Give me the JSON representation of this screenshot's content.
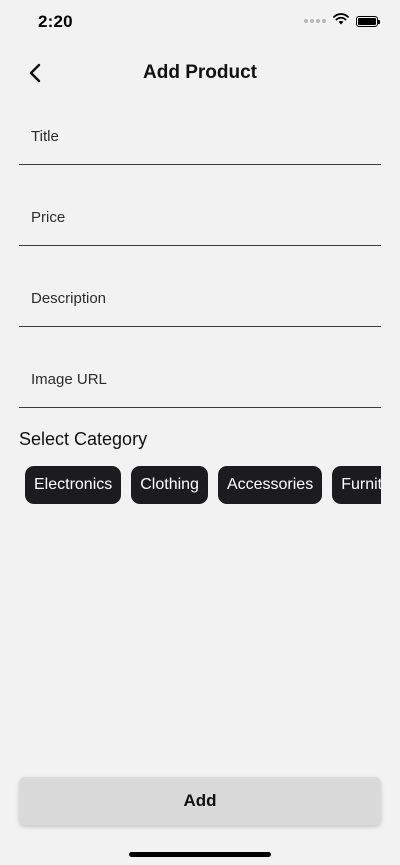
{
  "status_bar": {
    "time": "2:20"
  },
  "nav": {
    "title": "Add Product"
  },
  "form": {
    "title_placeholder": "Title",
    "price_placeholder": "Price",
    "description_placeholder": "Description",
    "image_url_placeholder": "Image URL"
  },
  "category": {
    "label": "Select Category",
    "options": [
      "Electronics",
      "Clothing",
      "Accessories",
      "Furniture"
    ]
  },
  "actions": {
    "add_label": "Add"
  },
  "colors": {
    "background": "#f2f2f2",
    "chip_background": "#1c1c1e",
    "chip_text": "#ffffff",
    "button_background": "#d9d9d9"
  }
}
